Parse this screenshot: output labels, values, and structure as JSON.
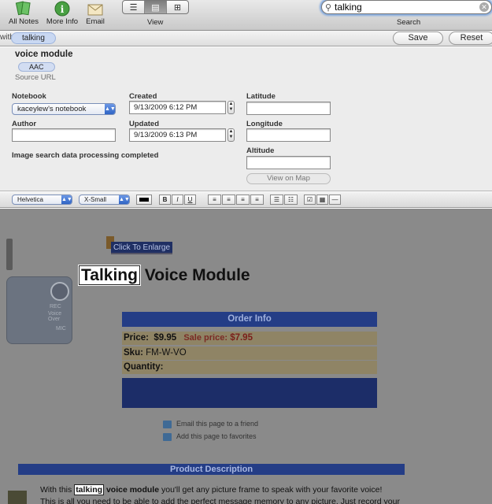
{
  "toolbar": {
    "all_notes": "All Notes",
    "more_info": "More Info",
    "email": "Email",
    "view_label": "View",
    "search_label": "Search",
    "search_value": "talking",
    "view_modes": [
      "☰",
      "▤",
      "⊞"
    ]
  },
  "filter": {
    "with_text": "with",
    "pill": "talking",
    "save": "Save",
    "reset": "Reset"
  },
  "note": {
    "title": "voice module",
    "tag": "AAC",
    "source_url_label": "Source URL",
    "notebook_label": "Notebook",
    "notebook_value": "kaceylew's notebook",
    "author_label": "Author",
    "author_value": "",
    "created_label": "Created",
    "created_value": "9/13/2009   6:12 PM",
    "updated_label": "Updated",
    "updated_value": "9/13/2009   6:13 PM",
    "latitude_label": "Latitude",
    "longitude_label": "Longitude",
    "altitude_label": "Altitude",
    "status": "Image search data processing completed",
    "view_on_map": "View on Map"
  },
  "format": {
    "font": "Helvetica",
    "size": "X-Small",
    "bold": "B",
    "italic": "I",
    "underline": "U"
  },
  "content": {
    "enlarge": "Click To Enlarge",
    "title_highlight": "Talking",
    "title_rest": " Voice Module",
    "device_rec": "REC",
    "device_voice": "Voice Over",
    "device_mic": "MIC",
    "order_info": "Order Info",
    "price_label": "Price:",
    "price_value": "$9.95",
    "sale_label": "Sale price:",
    "sale_value": "$7.95",
    "sku_label": "Sku:",
    "sku_value": "FM-W-VO",
    "quantity_label": "Quantity:",
    "email_friend": "Email this page to a friend",
    "add_favorites": "Add this page to favorites",
    "product_description": "Product Description",
    "desc_pre": "With this ",
    "desc_hl": "talking",
    "desc_bold": " voice module",
    "desc_post": " you'll get any picture frame to speak with your favorite voice!",
    "desc_line2": "This is all you need to be able to add the perfect message memory to any picture. Just record your"
  }
}
